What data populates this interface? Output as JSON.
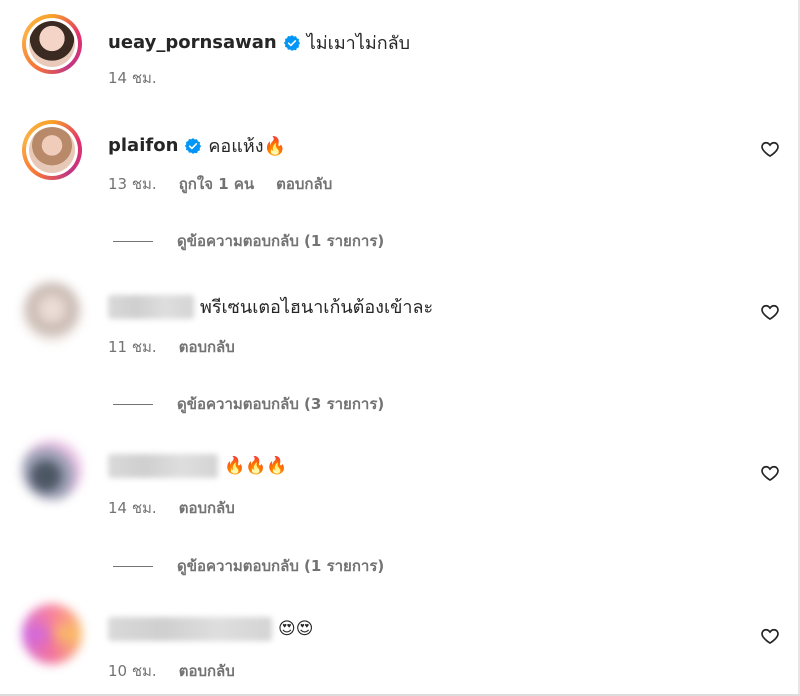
{
  "comments": [
    {
      "username": "ueay_pornsawan",
      "verified": true,
      "text": "ไม่เมาไม่กลับ",
      "time": "14 ชม.",
      "likes": "",
      "reply": ""
    },
    {
      "username": "plaifon",
      "verified": true,
      "text": "คอแห้ง🔥",
      "time": "13 ชม.",
      "likes": "ถูกใจ 1 คน",
      "reply": "ตอบกลับ",
      "view_replies": "ดูข้อความตอบกลับ (1 รายการ)"
    },
    {
      "username_hidden": true,
      "text": "พรีเซนเตอไฮนาเก้นต้องเข้าละ",
      "time": "11 ชม.",
      "reply": "ตอบกลับ",
      "view_replies": "ดูข้อความตอบกลับ (3 รายการ)"
    },
    {
      "username_hidden": true,
      "text": "🔥🔥🔥",
      "time": "14 ชม.",
      "reply": "ตอบกลับ",
      "view_replies": "ดูข้อความตอบกลับ (1 รายการ)"
    },
    {
      "username_hidden": true,
      "text": "😍😍",
      "time": "10 ชม.",
      "reply": "ตอบกลับ"
    }
  ],
  "colors": {
    "verified": "#0095f6",
    "meta": "#737373",
    "text": "#262626"
  },
  "icons": {
    "like": "heart-icon",
    "verified": "verified-badge-icon"
  }
}
